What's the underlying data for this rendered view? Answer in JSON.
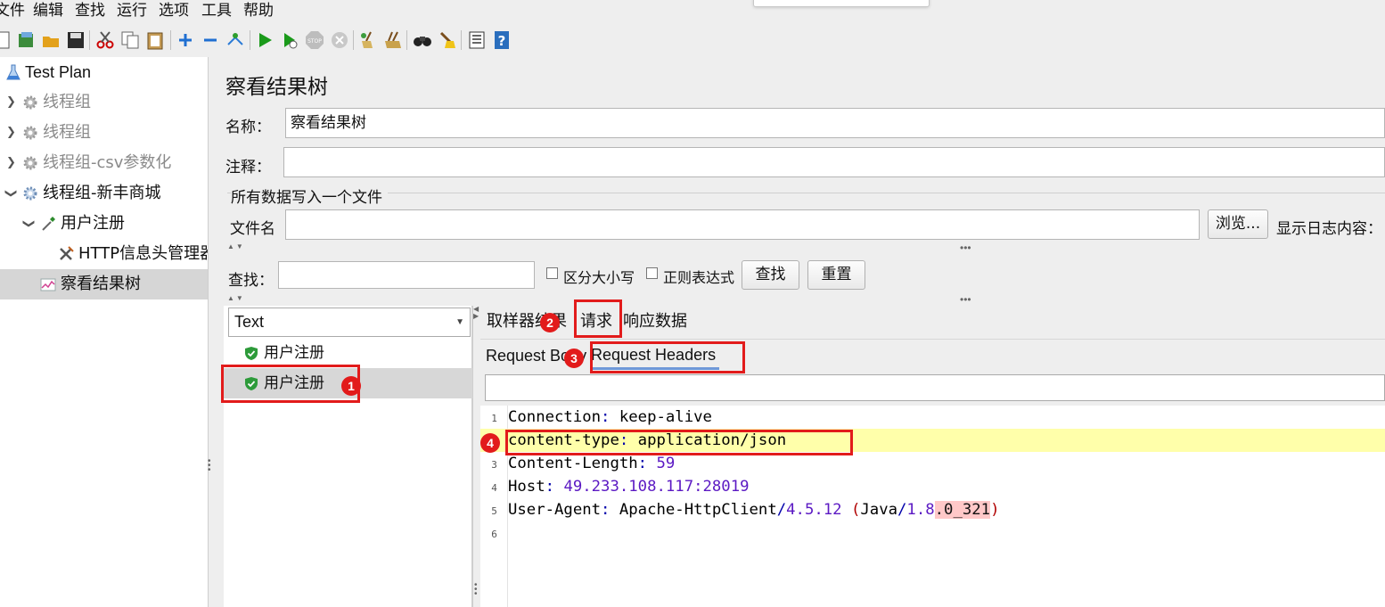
{
  "menu": [
    "文件",
    "编辑",
    "查找",
    "运行",
    "选项",
    "工具",
    "帮助"
  ],
  "toolbar": {
    "icons": [
      "new-icon",
      "templates-icon",
      "open-icon",
      "save-icon",
      "cut-icon",
      "copy-icon",
      "paste-icon",
      "expand-icon",
      "collapse-icon",
      "toggle-icon",
      "start-icon",
      "start-no-pause-icon",
      "stop-icon",
      "shutdown-icon",
      "clear-icon",
      "clear-all-icon",
      "search-icon",
      "reset-search-icon",
      "function-helper-icon",
      "help-icon"
    ]
  },
  "tree": {
    "items": [
      {
        "label": "Test Plan",
        "icon": "test-plan-icon",
        "disabled": false
      },
      {
        "label": "线程组",
        "icon": "gear-icon",
        "disabled": true
      },
      {
        "label": "线程组",
        "icon": "gear-icon",
        "disabled": true
      },
      {
        "label": "线程组-csv参数化",
        "icon": "gear-icon",
        "disabled": true
      },
      {
        "label": "线程组-新丰商城",
        "icon": "gear-icon",
        "disabled": false
      },
      {
        "label": "用户注册",
        "icon": "pipette-icon",
        "disabled": false
      },
      {
        "label": "HTTP信息头管理器",
        "icon": "tools-icon",
        "disabled": false
      },
      {
        "label": "察看结果树",
        "icon": "chart-icon",
        "disabled": false
      }
    ]
  },
  "panel": {
    "title": "察看结果树",
    "name_label": "名称：",
    "name_value": "察看结果树",
    "comment_label": "注释：",
    "comment_value": "",
    "file_section_label": "所有数据写入一个文件",
    "filename_label": "文件名",
    "filename_value": "",
    "browse_button": "浏览...",
    "log_label": "显示日志内容：",
    "search_label": "查找：",
    "search_value": "",
    "case_sensitive_label": "区分大小写",
    "regex_label": "正则表达式",
    "find_button": "查找",
    "reset_button": "重置"
  },
  "results": {
    "renderer_selected": "Text",
    "items": [
      {
        "label": "用户注册",
        "status": "success"
      },
      {
        "label": "用户注册",
        "status": "success"
      }
    ]
  },
  "detail": {
    "tabs": {
      "sampler_result": "取样器结果",
      "request": "请求",
      "response_data": "响应数据"
    },
    "subtabs": {
      "request_body": "Request Body",
      "request_headers": "Request Headers"
    },
    "filter_value": "",
    "lines": [
      {
        "num": "1",
        "key": "Connection",
        "sep": ": ",
        "val": "keep-alive"
      },
      {
        "num": "2",
        "key": "content-type",
        "sep": ": ",
        "val": "application/json"
      },
      {
        "num": "3",
        "key": "Content-Length",
        "sep": ": ",
        "val": "59"
      },
      {
        "num": "4",
        "key": "Host",
        "sep": ": ",
        "val": "49.233.108.117:28019"
      },
      {
        "num": "5",
        "key": "User-Agent",
        "sep": ": ",
        "val": "Apache-HttpClient/4.5.12 (Java/1.8.0_321)"
      },
      {
        "num": "6",
        "key": "",
        "sep": "",
        "val": ""
      }
    ]
  },
  "annotations": [
    "1",
    "2",
    "3",
    "4"
  ],
  "colors": {
    "annotation": "#e21b1b",
    "highlight_line": "#ffffaa",
    "number": "#5b19c3",
    "punct": "#0000aa",
    "paren": "#b00000"
  }
}
